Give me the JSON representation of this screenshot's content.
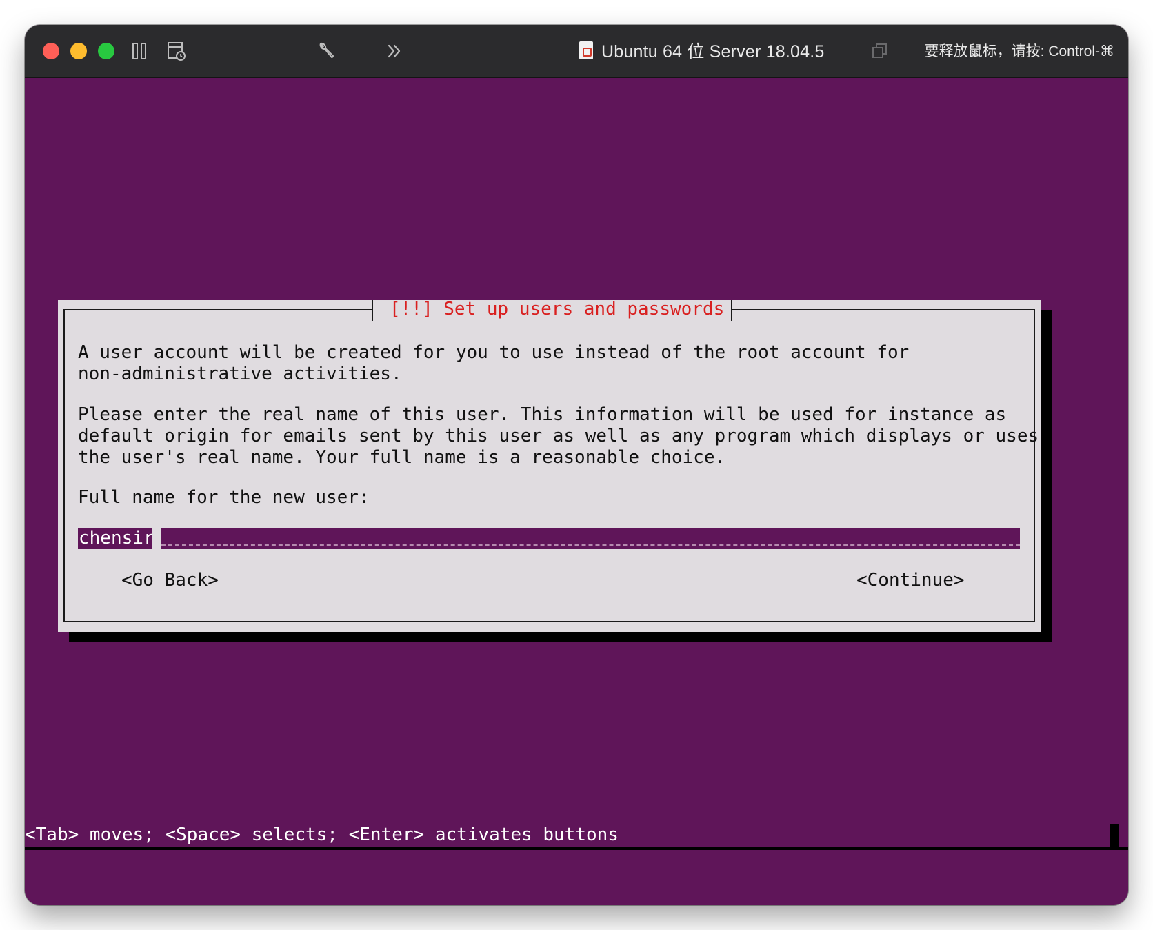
{
  "titlebar": {
    "vm_title": "Ubuntu 64 位 Server 18.04.5",
    "release_hint": "要释放鼠标，请按: Control-⌘"
  },
  "icons": {
    "pause": "pause-icon",
    "snapshot": "snapshot-icon",
    "settings": "wrench-icon",
    "more": "double-chevron-right-icon",
    "document": "vm-document-icon",
    "window": "window-copy-icon"
  },
  "dialog": {
    "title": "[!!] Set up users and passwords",
    "paragraph1": "A user account will be created for you to use instead of the root account for\nnon-administrative activities.",
    "paragraph2": "Please enter the real name of this user. This information will be used for instance as\ndefault origin for emails sent by this user as well as any program which displays or uses\nthe user's real name. Your full name is a reasonable choice.",
    "prompt": "Full name for the new user:",
    "full_name_value": "chensir",
    "go_back": "<Go Back>",
    "continue": "<Continue>"
  },
  "help_bar": "<Tab> moves; <Space> selects; <Enter> activates buttons",
  "colors": {
    "console_bg": "#5f1559",
    "dialog_bg": "#e0dce0",
    "title_red": "#d92020",
    "titlebar_bg": "#2b2b2d"
  }
}
